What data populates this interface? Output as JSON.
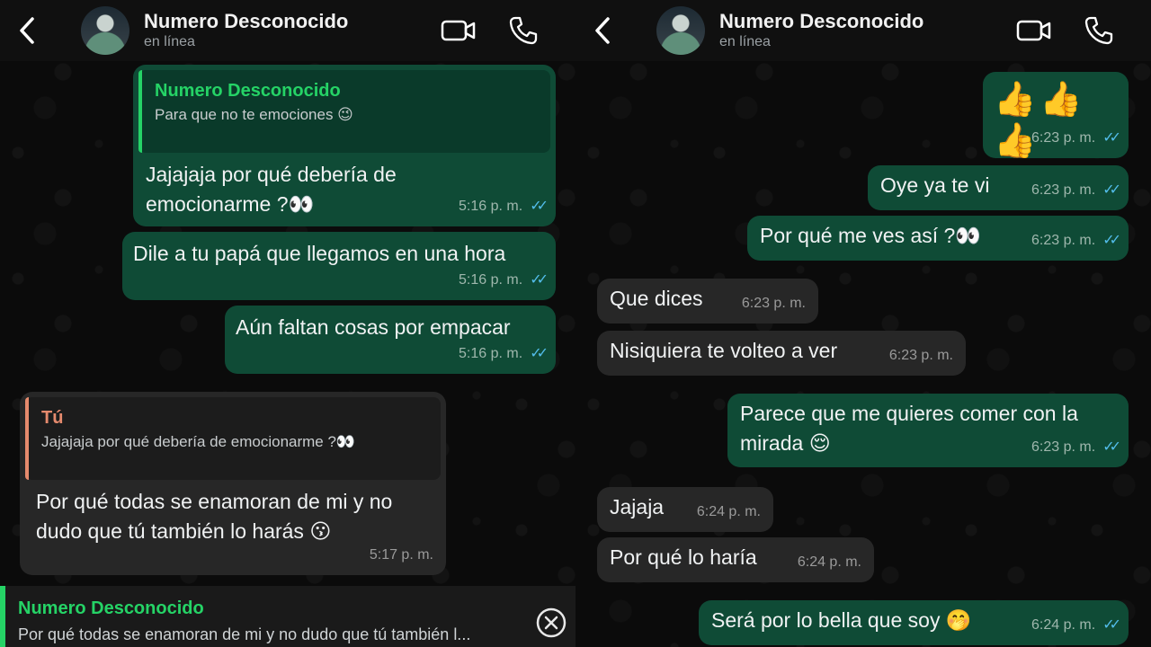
{
  "contact": {
    "name": "Numero Desconocido",
    "status": "en línea"
  },
  "icons": {
    "back": "chevron-left-icon",
    "video": "video-camera-icon",
    "phone": "phone-icon",
    "close": "close-circle-icon"
  },
  "colors": {
    "outgoing_bubble": "#0f4b36",
    "incoming_bubble": "#272727",
    "accent_green": "#25d366",
    "quote_orange": "#e58a6d",
    "read_ticks": "#53bdeb"
  },
  "left": {
    "messages": [
      {
        "quote_author": "Numero Desconocido",
        "quote_text": "Para que no te emociones 😉",
        "text": "Jajajaja por qué debería de emocionarme ?👀",
        "time": "5:16 p. m.",
        "ticks": "✓✓"
      },
      {
        "text": "Dile a tu papá que llegamos en una hora",
        "time": "5:16 p. m.",
        "ticks": "✓✓"
      },
      {
        "text": "Aún faltan cosas por empacar",
        "time": "5:16 p. m.",
        "ticks": "✓✓"
      },
      {
        "quote_author": "Tú",
        "quote_text": "Jajajaja por qué debería de emocionarme ?👀",
        "text": "Por qué todas se enamoran de mi y no dudo que tú también lo harás 😗",
        "time": "5:17 p. m."
      }
    ],
    "reply": {
      "author": "Numero Desconocido",
      "text": "Por qué todas se enamoran de mi y no dudo que tú también l..."
    }
  },
  "right": {
    "messages": [
      {
        "text": "👍👍👍",
        "time": "6:23 p. m.",
        "ticks": "✓✓"
      },
      {
        "text": "Oye ya te vi",
        "time": "6:23 p. m.",
        "ticks": "✓✓"
      },
      {
        "text": "Por qué me ves así ?👀",
        "time": "6:23 p. m.",
        "ticks": "✓✓"
      },
      {
        "text": "Que dices",
        "time": "6:23 p. m."
      },
      {
        "text": "Nisiquiera te volteo a ver",
        "time": "6:23 p. m."
      },
      {
        "text": "Parece que me quieres comer con la mirada 😌",
        "time": "6:23 p. m.",
        "ticks": "✓✓"
      },
      {
        "text": "Jajaja",
        "time": "6:24 p. m."
      },
      {
        "text": "Por qué lo haría",
        "time": "6:24 p. m."
      },
      {
        "text": "Será por lo bella que soy 🤭",
        "time": "6:24 p. m.",
        "ticks": "✓✓"
      }
    ]
  }
}
